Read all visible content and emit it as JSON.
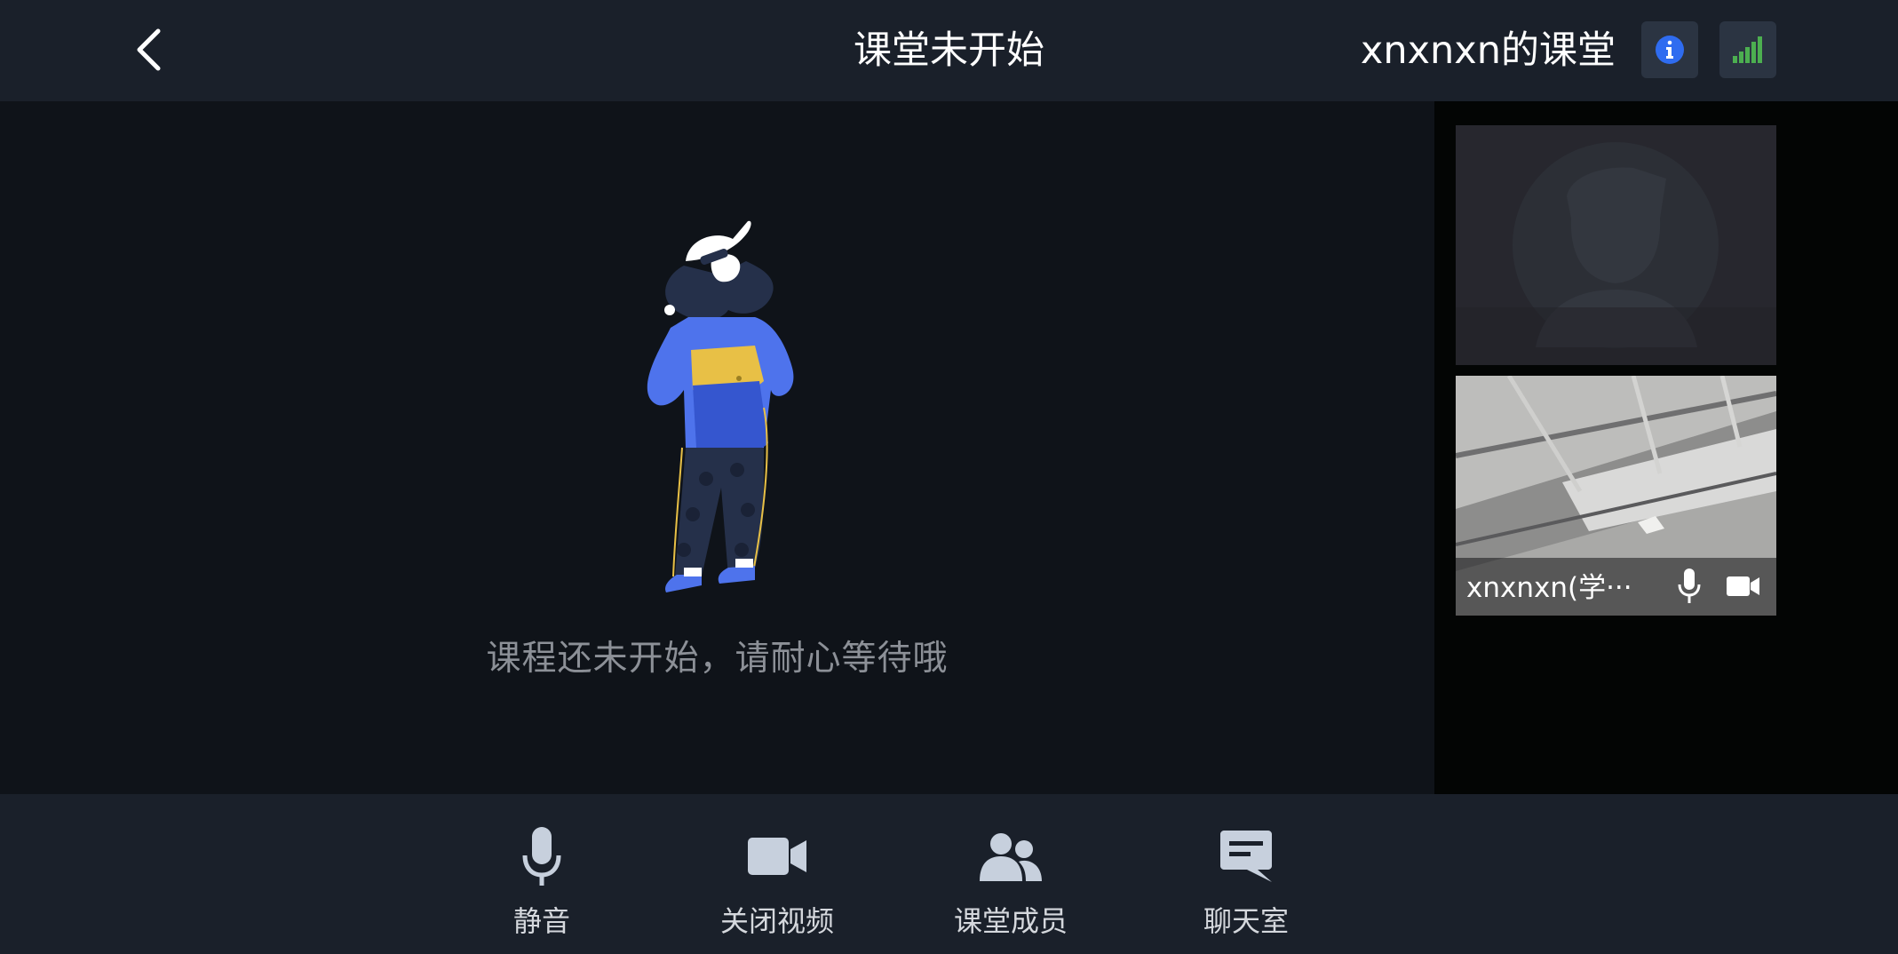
{
  "header": {
    "title": "课堂未开始",
    "room_name": "xnxnxn的课堂"
  },
  "main": {
    "waiting_message": "课程还未开始，请耐心等待哦"
  },
  "sidebar": {
    "tiles": [
      {
        "member_name": ""
      },
      {
        "member_name": "xnxnxn(学···"
      }
    ]
  },
  "toolbar": {
    "mute_label": "静音",
    "video_label": "关闭视频",
    "members_label": "课堂成员",
    "chat_label": "聊天室"
  },
  "colors": {
    "info_accent": "#2f6cf0",
    "signal_green": "#4caf50"
  }
}
